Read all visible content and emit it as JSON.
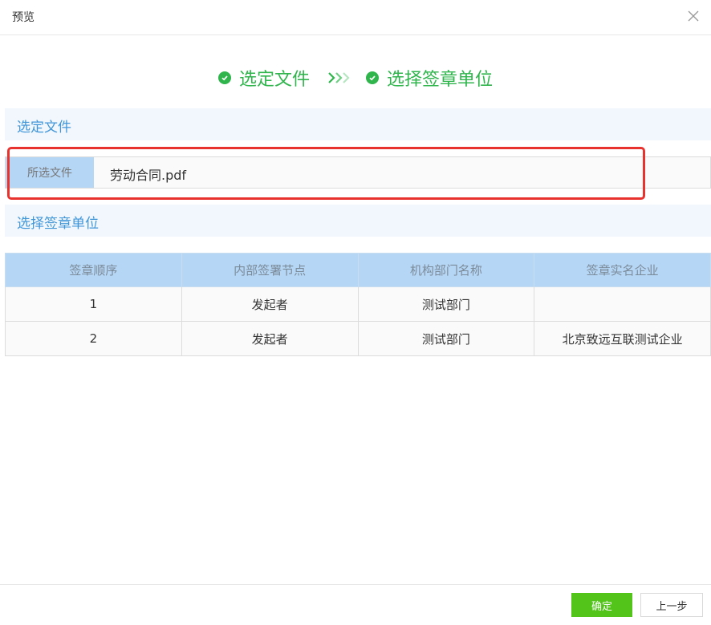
{
  "dialog": {
    "title": "预览",
    "close_icon": "close-icon"
  },
  "steps": [
    {
      "label": "选定文件",
      "icon": "check-circle-icon",
      "status": "done"
    },
    {
      "label": "选择签章单位",
      "icon": "check-circle-icon",
      "status": "done"
    }
  ],
  "step_separator_icon": "triple-chevron-right-icon",
  "colors": {
    "step_green": "#2fb54c",
    "section_text": "#4196d8",
    "section_bg": "#f1f7fd",
    "label_bg": "#b5d6f5",
    "highlight": "#e8322e",
    "confirm_button": "#52c41a"
  },
  "section_file": {
    "title": "选定文件",
    "field_label": "所选文件",
    "field_value": "劳动合同.pdf"
  },
  "section_unit": {
    "title": "选择签章单位",
    "table": {
      "headers": [
        "签章顺序",
        "内部签署节点",
        "机构部门名称",
        "签章实名企业"
      ],
      "rows": [
        [
          "1",
          "发起者",
          "测试部门",
          ""
        ],
        [
          "2",
          "发起者",
          "测试部门",
          "北京致远互联测试企业"
        ]
      ]
    }
  },
  "footer": {
    "confirm_label": "确定",
    "prev_label": "上一步"
  }
}
